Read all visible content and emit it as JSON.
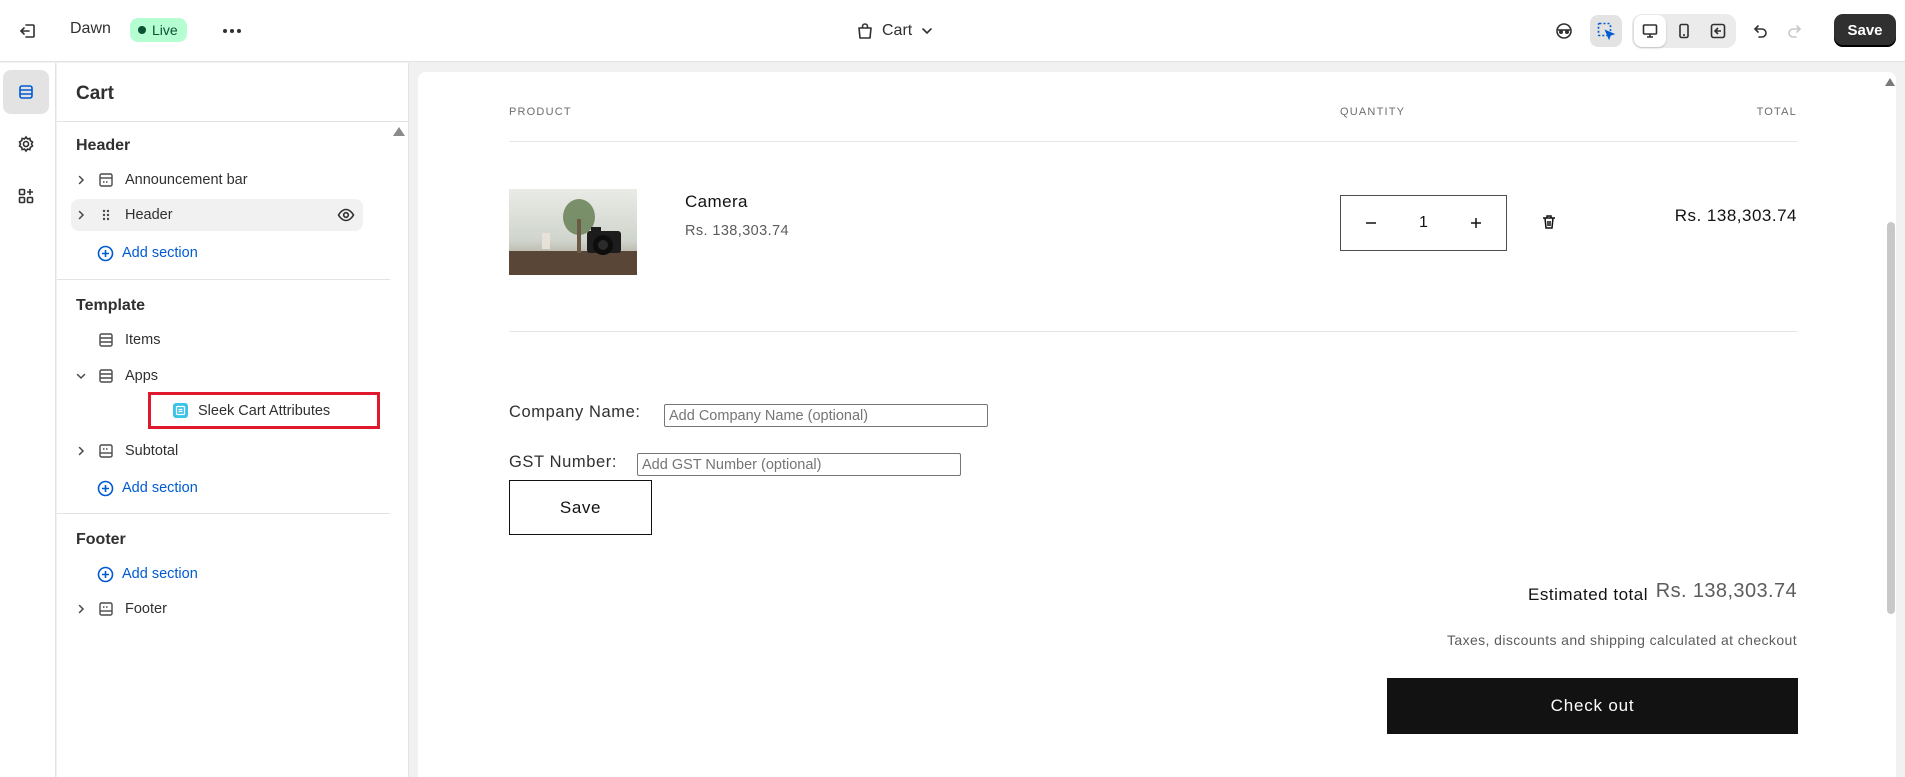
{
  "topbar": {
    "theme_name": "Dawn",
    "live_badge": "Live",
    "page_selector": "Cart",
    "save_label": "Save"
  },
  "sidebar": {
    "title": "Cart",
    "groups": {
      "header": {
        "title": "Header",
        "items": [
          "Announcement bar",
          "Header"
        ],
        "add_section": "Add section"
      },
      "template": {
        "title": "Template",
        "items": [
          "Items",
          "Apps",
          "Subtotal"
        ],
        "app_block": "Sleek Cart Attributes",
        "add_section": "Add section"
      },
      "footer": {
        "title": "Footer",
        "items": [
          "Footer"
        ],
        "add_section": "Add section"
      }
    }
  },
  "preview": {
    "columns": {
      "product": "PRODUCT",
      "quantity": "QUANTITY",
      "total": "TOTAL"
    },
    "item": {
      "name": "Camera",
      "price": "Rs. 138,303.74",
      "quantity": "1",
      "total": "Rs. 138,303.74"
    },
    "form": {
      "company_label": "Company Name:",
      "company_placeholder": "Add Company Name (optional)",
      "gst_label": "GST Number:",
      "gst_placeholder": "Add GST Number (optional)",
      "save_label": "Save"
    },
    "summary": {
      "estimated_label": "Estimated total",
      "estimated_value": "Rs. 138,303.74",
      "taxes_note": "Taxes, discounts and shipping calculated at checkout",
      "checkout_label": "Check out"
    }
  },
  "colors": {
    "accent_link": "#005bd3",
    "live_badge_bg": "#b4fed2",
    "highlight_box": "#e0182d",
    "checkout_bg": "#121212"
  }
}
